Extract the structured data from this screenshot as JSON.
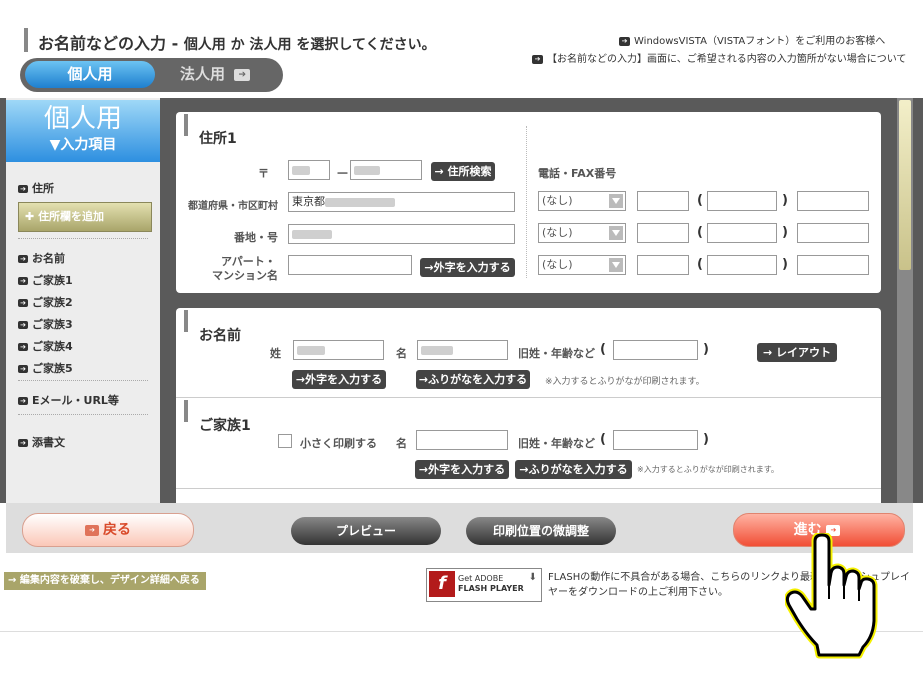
{
  "header": {
    "title": "お名前などの入力",
    "title_sep": "-",
    "subtitle": "個人用 か 法人用 を選択してください。",
    "link_vista": "WindowsVISTA（VISTAフォント）をご利用のお客様へ",
    "link_missing": "【お名前などの入力】画面に、ご希望される内容の入力箇所がない場合について"
  },
  "tabs": {
    "personal": "個人用",
    "corporate": "法人用"
  },
  "sidebar": {
    "heading_big": "個人用",
    "heading_small": "▼入力項目",
    "items": [
      "住所",
      "お名前",
      "ご家族1",
      "ご家族2",
      "ご家族3",
      "ご家族4",
      "ご家族5",
      "Eメール・URL等",
      "添書文"
    ],
    "add_address": "住所欄を追加"
  },
  "address": {
    "section_title": "住所1",
    "postal_mark": "〒",
    "postal_dash": "－",
    "search_button": "住所検索",
    "pref_label": "都道府県・市区町村",
    "pref_value": "東京都",
    "banchi_label": "番地・号",
    "apt_label_1": "アパート・",
    "apt_label_2": "マンション名",
    "gaiji_button": "外字を入力する",
    "phone_title": "電話・FAX番号",
    "phone_types": [
      "(なし)",
      "(なし)",
      "(なし)"
    ],
    "open_paren": "(",
    "close_paren": ")"
  },
  "name_section": {
    "title": "お名前",
    "sei_label": "姓",
    "mei_label": "名",
    "kyusei_label": "旧姓・年齢など",
    "open_paren": "(",
    "close_paren": ")",
    "layout_button": "レイアウト",
    "gaiji_button": "外字を入力する",
    "furigana_button": "ふりがなを入力する",
    "note": "※入力するとふりがなが印刷されます。"
  },
  "family1": {
    "title": "ご家族1",
    "small_print_label": "小さく印刷する",
    "mei_label": "名",
    "kyusei_label": "旧姓・年齢など",
    "open_paren": "(",
    "close_paren": ")",
    "gaiji_button": "外字を入力する",
    "furigana_button": "ふりがなを入力する",
    "note": "※入力するとふりがなが印刷されます。"
  },
  "bottom": {
    "back": "戻る",
    "preview": "プレビュー",
    "adjust": "印刷位置の微調整",
    "next": "進む"
  },
  "footer": {
    "discard_link": "編集内容を破棄し、デザイン詳細へ戻る",
    "flash_get": "Get ADOBE",
    "flash_player": "FLASH PLAYER",
    "flash_note": "FLASHの動作に不具合がある場合、こちらのリンクより最新のフラッシュプレイヤーをダウンロードの上ご利用下さい。"
  },
  "colors": {
    "accent_blue": "#1e7fcf",
    "next_red": "#f14e35",
    "olive": "#a9a56a"
  },
  "icons": [
    "arrow-right-square-icon",
    "plus-icon",
    "hand-pointer-icon",
    "flash-logo-icon",
    "arrow-left-square-icon"
  ]
}
